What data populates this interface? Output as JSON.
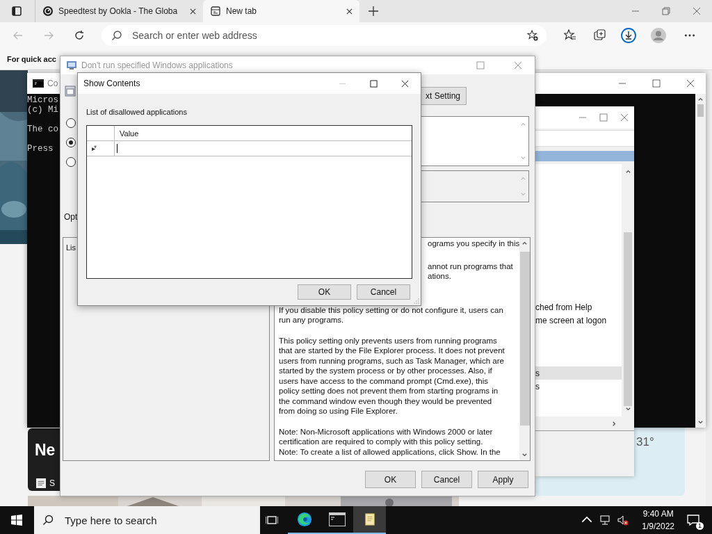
{
  "browser": {
    "tabs": [
      {
        "title": "Speedtest by Ookla - The Globa",
        "kind": "gauge",
        "selected": false
      },
      {
        "title": "New tab",
        "kind": "page",
        "selected": true
      }
    ],
    "address": {
      "placeholder": "Search or enter web address"
    },
    "favorites_bar": "For quick acc"
  },
  "page": {
    "news_heading": "Ne",
    "news_source": "S",
    "weather_temp": "31°"
  },
  "cmd_window": {
    "title": "Co",
    "paragraphs": [
      [
        "Micros",
        "(c) Mi"
      ],
      [
        "The co"
      ],
      [
        "Press"
      ]
    ]
  },
  "back_window": {
    "rows": [
      {
        "text": "ched from Help",
        "shaded": false
      },
      {
        "text": "me screen at logon",
        "shaded": false
      },
      {
        "text": "s",
        "shaded": true
      },
      {
        "text": "s",
        "shaded": false
      }
    ]
  },
  "policy_dialog": {
    "title": "Don't run specified Windows applications",
    "next_button": "xt Setting",
    "radios": [
      {
        "selected": false
      },
      {
        "selected": true
      },
      {
        "selected": false
      }
    ],
    "options_label": "Opt",
    "options_list": "Lis",
    "help_paragraphs": [
      {
        "kind": "clipped",
        "lines": [
          "ograms you specify in this"
        ]
      },
      {
        "kind": "clipped",
        "lines": [
          "annot run programs that",
          "ations."
        ]
      },
      {
        "kind": "full",
        "lines": [
          "If you disable this policy setting or do not configure it, users can",
          "run any programs."
        ]
      },
      {
        "kind": "full",
        "lines": [
          "This policy setting only prevents users from running programs",
          "that are started by the File Explorer process. It does not prevent",
          "users from running programs, such as Task Manager, which are",
          "started by the system process or by other processes.  Also, if",
          "users have access to the command prompt (Cmd.exe), this",
          "policy setting does not prevent them from starting programs in",
          "the command window even though they would be prevented",
          "from doing so using File Explorer."
        ]
      },
      {
        "kind": "full",
        "lines": [
          "Note: Non-Microsoft applications with Windows 2000 or later",
          "certification are required to comply with this policy setting.",
          "Note: To create a list of allowed applications, click Show.  In the"
        ]
      }
    ],
    "buttons": [
      "OK",
      "Cancel",
      "Apply"
    ]
  },
  "show_contents": {
    "title": "Show Contents",
    "label": "List of disallowed applications",
    "column": "Value",
    "row_marker": "▸*",
    "buttons": [
      "OK",
      "Cancel"
    ]
  },
  "taskbar": {
    "search_placeholder": "Type here to search",
    "apps": [
      {
        "kind": "browser",
        "selected": false
      },
      {
        "kind": "terminal",
        "selected": false
      },
      {
        "kind": "notepad",
        "selected": true
      }
    ],
    "time": "9:40 AM",
    "date": "1/9/2022",
    "notifications": "1"
  }
}
